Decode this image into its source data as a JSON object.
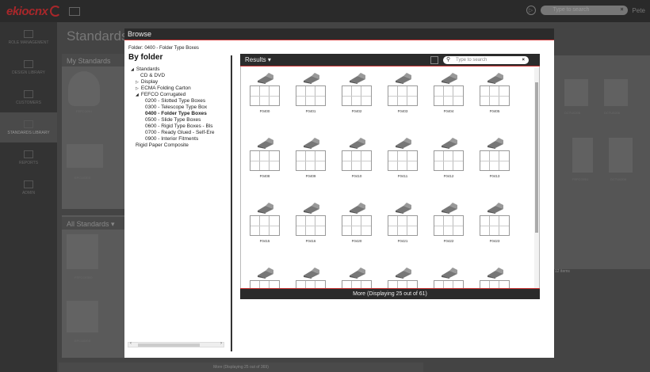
{
  "topbar": {
    "logo": "cnx",
    "search_placeholder": "Type to search",
    "user": "Pete"
  },
  "nav": {
    "items": [
      {
        "label": "Role Management",
        "active": false
      },
      {
        "label": "Design Library",
        "active": false
      },
      {
        "label": "Customers",
        "active": false
      },
      {
        "label": "Standards Library",
        "active": true
      },
      {
        "label": "Reports",
        "active": false
      },
      {
        "label": "Admin",
        "active": false
      }
    ]
  },
  "background": {
    "title": "Standards",
    "my_standards": "My Standards",
    "all_standards": "All Standards",
    "more": "More (Displaying 25 out of 369)",
    "items_count": "12 items",
    "thumb_labels": [
      "FEFCO001",
      "DCTU0206",
      "EFCO0203",
      "FEFCO0300",
      "EFCO0203",
      "DCTU0206",
      "FEFCO001",
      "DCTU0206"
    ]
  },
  "dialog": {
    "title": "Browse",
    "breadcrumb": "Folder: 0400 - Folder Type Boxes",
    "heading": "By folder",
    "tree": [
      {
        "label": "Standards",
        "prefix": "◢",
        "indent": 0,
        "selected": false
      },
      {
        "label": "CD & DVD",
        "prefix": "",
        "indent": 2,
        "selected": false
      },
      {
        "label": "Display",
        "prefix": "▷",
        "indent": 1,
        "selected": false
      },
      {
        "label": "ECMA Folding Carton",
        "prefix": "▷",
        "indent": 1,
        "selected": false
      },
      {
        "label": "FEFCO Corrugated",
        "prefix": "◢",
        "indent": 1,
        "selected": false
      },
      {
        "label": "0200 - Slotted Type Boxes",
        "prefix": "",
        "indent": 3,
        "selected": false
      },
      {
        "label": "0300 - Telescope Type Box",
        "prefix": "",
        "indent": 3,
        "selected": false
      },
      {
        "label": "0400 - Folder Type Boxes",
        "prefix": "",
        "indent": 3,
        "selected": true
      },
      {
        "label": "0500 - Slide Type Boxes",
        "prefix": "",
        "indent": 3,
        "selected": false
      },
      {
        "label": "0600 - Rigid Type Boxes - Bls",
        "prefix": "",
        "indent": 3,
        "selected": false
      },
      {
        "label": "0700 - Ready Glued - Self-Ere",
        "prefix": "",
        "indent": 3,
        "selected": false
      },
      {
        "label": "0900 - Interior Fitments",
        "prefix": "",
        "indent": 3,
        "selected": false
      },
      {
        "label": "Rigid Paper Composite",
        "prefix": "",
        "indent": 1,
        "selected": false
      }
    ],
    "results": {
      "label": "Results",
      "search_placeholder": "Type to search",
      "more": "More (Displaying 25 out of 61)",
      "items": [
        "F0400",
        "F0401",
        "F0402",
        "F0403",
        "F0404",
        "F0405",
        "F0408",
        "F0409",
        "F0410",
        "F0411",
        "F0412",
        "F0413",
        "F0415",
        "F0416",
        "F0420",
        "F0421",
        "F0422",
        "F0423",
        "",
        "",
        "",
        "",
        "",
        ""
      ]
    }
  }
}
